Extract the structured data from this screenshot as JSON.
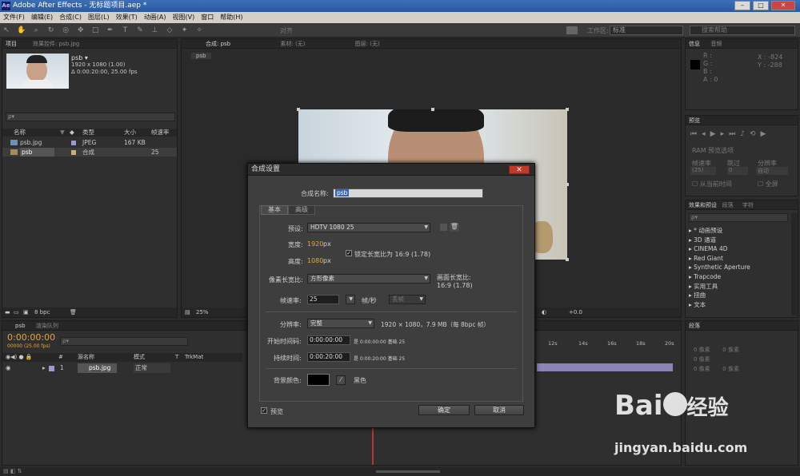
{
  "titlebar": {
    "title": "Adobe After Effects - 无标题项目.aep *",
    "logo": "Ae"
  },
  "menu": [
    "文件(F)",
    "编辑(E)",
    "合成(C)",
    "图层(L)",
    "效果(T)",
    "动画(A)",
    "视图(V)",
    "窗口",
    "帮助(H)"
  ],
  "toolbar": {
    "align_label": "对齐",
    "workspace_label": "工作区:",
    "workspace_value": "标准",
    "search_placeholder": "搜索帮助"
  },
  "project": {
    "tab1": "项目",
    "tab2": "效果控件: psb.jpg",
    "item_name": "psb ▾",
    "item_size": "1920 x 1080 (1.00)",
    "item_dur": "Δ 0:00:20:00, 25.00 fps",
    "search_placeholder": "ρ▾",
    "headers": {
      "name": "名称",
      "type": "类型",
      "size": "大小",
      "fps": "帧速率"
    },
    "rows": [
      {
        "name": "psb.jpg",
        "type": "JPEG",
        "size": "167 KB",
        "fps": ""
      },
      {
        "name": "psb",
        "type": "合成",
        "size": "",
        "fps": "25"
      }
    ],
    "footer_bpc": "8 bpc"
  },
  "viewer": {
    "tab1": "合成: psb",
    "tab2": "素材: (无)",
    "tab3": "图层: (无)",
    "crumb": "psb",
    "zoom": "25%",
    "exposure": "+0.0"
  },
  "info": {
    "tab1": "信息",
    "tab2": "音频",
    "r": "R :",
    "g": "G :",
    "b": "B :",
    "a": "A : 0",
    "x": "X : -824",
    "y": "Y : -288"
  },
  "preview": {
    "tab": "预览",
    "ram": "RAM 预览选项",
    "frame_rate": "帧速率",
    "skip": "跳过",
    "resolution": "分辨率",
    "fr_val": "(25)",
    "skip_val": "0",
    "res_val": "自动",
    "from_current": "从当前时间",
    "fullscreen": "全屏"
  },
  "effects": {
    "tab1": "效果和预设",
    "tab2": "段落",
    "tab3": "字符",
    "items": [
      "* 动画预设",
      "3D 通道",
      "CINEMA 4D",
      "Red Giant",
      "Synthetic Aperture",
      "Trapcode",
      "实用工具",
      "扭曲",
      "文本"
    ]
  },
  "timeline": {
    "tab1": "psb",
    "tab2": "渲染队列",
    "timecode": "0:00:00:00",
    "frames": "00000 (25.00 fps)",
    "headers": {
      "num": "#",
      "source": "源名称",
      "mode": "模式",
      "t": "T",
      "trkmat": "TrkMat"
    },
    "layer": {
      "num": "1",
      "name": "psb.jpg",
      "mode": "正常"
    },
    "ticks": [
      "12s",
      "14s",
      "16s",
      "18s",
      "20s"
    ]
  },
  "paragraph": {
    "tab": "段落",
    "vals": [
      "0 像素",
      "0 像素",
      "0 像素",
      "0 像素",
      "0 像素"
    ]
  },
  "dialog": {
    "title": "合成设置",
    "close": "✕",
    "comp_name_label": "合成名称:",
    "comp_name": "psb",
    "tab_basic": "基本",
    "tab_advanced": "高级",
    "preset_label": "预设:",
    "preset_value": "HDTV 1080 25",
    "width_label": "宽度:",
    "width_value": "1920",
    "height_label": "高度:",
    "height_value": "1080",
    "px": "px",
    "lock_ratio": "锁定长宽比为 16:9 (1.78)",
    "pixel_ratio_label": "像素长宽比:",
    "pixel_ratio_value": "方形像素",
    "frame_ratio_label": "画面长宽比:",
    "frame_ratio_value": "16:9 (1.78)",
    "fps_label": "帧速率:",
    "fps_value": "25",
    "fps_unit": "帧/秒",
    "drop_frame": "丢帧",
    "resolution_label": "分辨率:",
    "resolution_value": "完整",
    "resolution_info": "1920 × 1080，7.9 MB（每 8bpc 帧）",
    "start_label": "开始时间码:",
    "start_value": "0:00:00:00",
    "start_note": "是 0:00:00:00  基础 25",
    "duration_label": "持续时间:",
    "duration_value": "0:00:20:00",
    "duration_note": "是 0:00:20:00  基础 25",
    "bg_label": "背景颜色:",
    "bg_name": "黑色",
    "bg_color": "#000000",
    "preview_label": "预览",
    "ok": "确定",
    "cancel": "取消"
  },
  "watermark": {
    "brand": "Bai",
    "brand2": "经验",
    "url": "jingyan.baidu.com"
  },
  "colors": {
    "accent_orange": "#e8a43a",
    "title_blue": "#2a5aa0",
    "close_red": "#c0392b"
  }
}
